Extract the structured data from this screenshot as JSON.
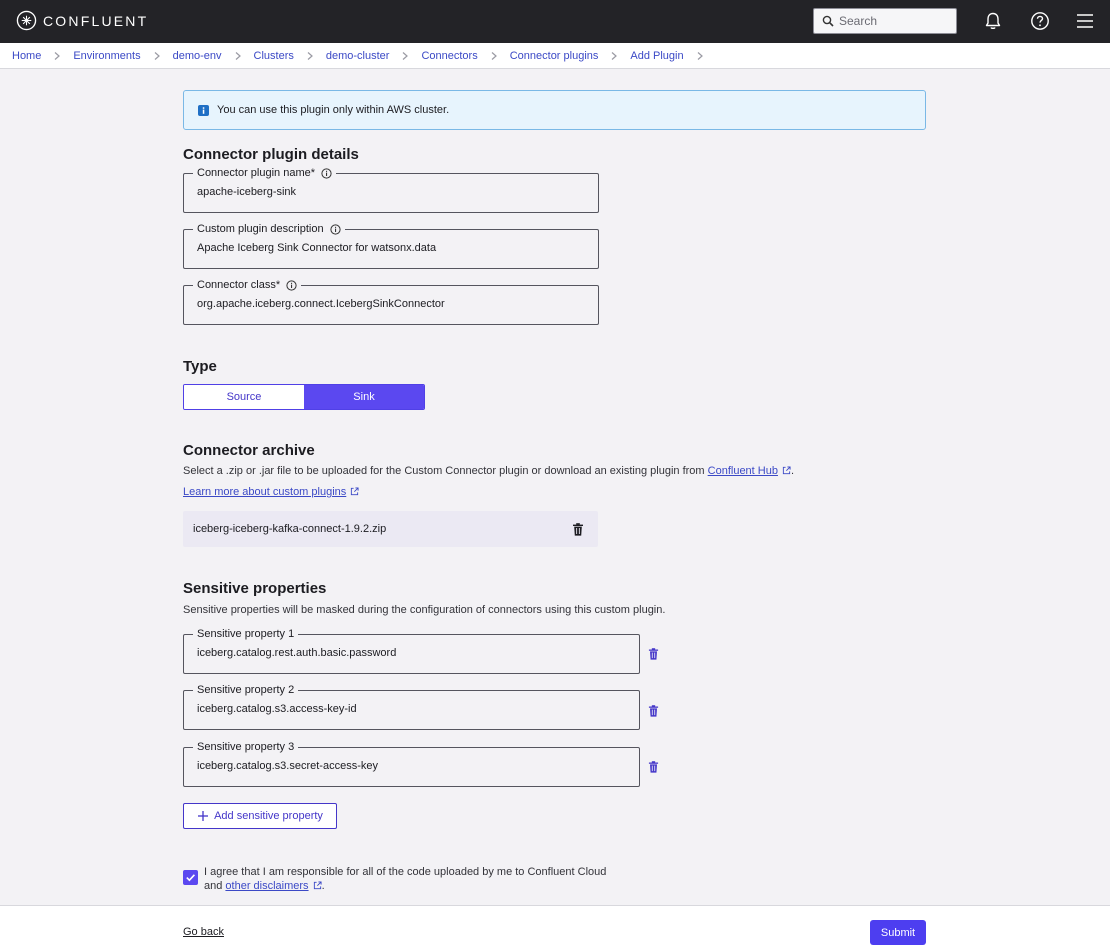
{
  "app": {
    "brand": "CONFLUENT"
  },
  "header": {
    "search_placeholder": "Search"
  },
  "breadcrumb": [
    "Home",
    "Environments",
    "demo-env",
    "Clusters",
    "demo-cluster",
    "Connectors",
    "Connector plugins",
    "Add Plugin"
  ],
  "banner": {
    "text": "You can use this plugin only within AWS cluster."
  },
  "details": {
    "heading": "Connector plugin details",
    "name_label": "Connector plugin name*",
    "name_value": "apache-iceberg-sink",
    "desc_label": "Custom plugin description",
    "desc_value": "Apache Iceberg Sink Connector for watsonx.data",
    "class_label": "Connector class*",
    "class_value": "org.apache.iceberg.connect.IcebergSinkConnector"
  },
  "type": {
    "heading": "Type",
    "source_label": "Source",
    "sink_label": "Sink",
    "selected": "Sink"
  },
  "archive": {
    "heading": "Connector archive",
    "desc_prefix": "Select a .zip or .jar file to be uploaded for the Custom Connector plugin or download an existing plugin from ",
    "hub_link": "Confluent Hub",
    "desc_suffix": ".",
    "learn_link": "Learn more about custom plugins",
    "file_name": "iceberg-iceberg-kafka-connect-1.9.2.zip"
  },
  "sensitive": {
    "heading": "Sensitive properties",
    "desc": "Sensitive properties will be masked during the configuration of connectors using this custom plugin.",
    "properties": [
      {
        "label": "Sensitive property 1",
        "value": "iceberg.catalog.rest.auth.basic.password"
      },
      {
        "label": "Sensitive property 2",
        "value": "iceberg.catalog.s3.access-key-id"
      },
      {
        "label": "Sensitive property 3",
        "value": "iceberg.catalog.s3.secret-access-key"
      }
    ],
    "add_label": "Add sensitive property"
  },
  "agreement": {
    "text": "I agree that I am responsible for all of the code uploaded by me to Confluent Cloud and ",
    "link": "other disclaimers",
    "suffix": ".",
    "checked": true
  },
  "footer": {
    "back_label": "Go back",
    "submit_label": "Submit"
  },
  "colors": {
    "accent": "#5b48f0",
    "link": "#3b49c6",
    "topbar": "#232327",
    "banner_bg": "#e7f4fd"
  }
}
